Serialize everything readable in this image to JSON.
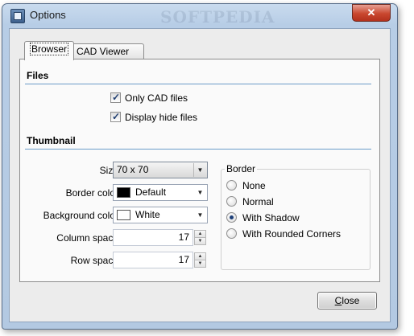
{
  "window": {
    "title": "Options",
    "watermark": "SOFTPEDIA"
  },
  "titlebar": {
    "close_glyph": "✕"
  },
  "tabs": [
    {
      "label": "Browser",
      "active": true
    },
    {
      "label": "CAD Viewer",
      "active": false
    }
  ],
  "files": {
    "header": "Files",
    "only_cad": {
      "label": "Only CAD files",
      "checked": true
    },
    "display_hide": {
      "label": "Display hide files",
      "checked": true
    }
  },
  "thumbnail": {
    "header": "Thumbnail",
    "size": {
      "label": "Size",
      "value": "70 x 70"
    },
    "border_color": {
      "label": "Border color",
      "value": "Default",
      "swatch": "#000000"
    },
    "background_color": {
      "label": "Background color",
      "value": "White",
      "swatch": "#ffffff"
    },
    "column_space": {
      "label": "Column space",
      "value": "17"
    },
    "row_space": {
      "label": "Row space",
      "value": "17"
    }
  },
  "border_group": {
    "label": "Border",
    "options": [
      {
        "label": "None",
        "selected": false
      },
      {
        "label": "Normal",
        "selected": false
      },
      {
        "label": "With Shadow",
        "selected": true
      },
      {
        "label": "With Rounded Corners",
        "selected": false
      }
    ]
  },
  "footer": {
    "close_label": "Close",
    "close_mnemonic": "C"
  }
}
